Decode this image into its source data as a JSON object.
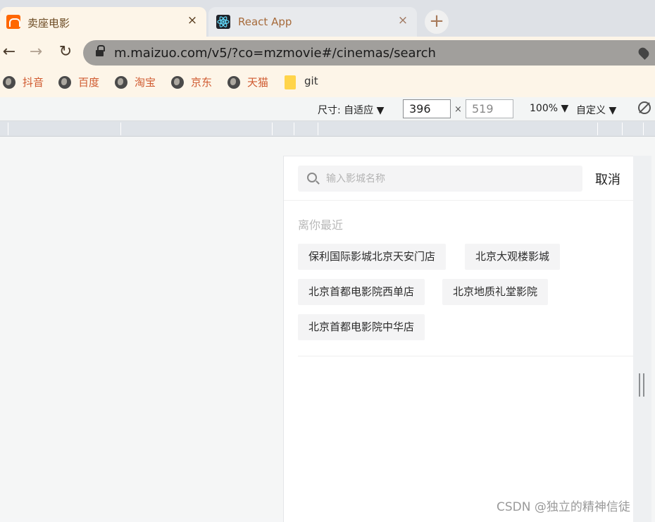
{
  "tabs": [
    {
      "title": "卖座电影",
      "close": "×",
      "active": true,
      "icon": "maizuo-favicon"
    },
    {
      "title": "React App",
      "close": "×",
      "active": false,
      "icon": "react-favicon"
    }
  ],
  "new_tab": "+",
  "nav": {
    "back": "←",
    "forward": "→",
    "reload": "↻"
  },
  "address_bar": {
    "url": "m.maizuo.com/v5/?co=mzmovie#/cinemas/search"
  },
  "bookmarks": [
    {
      "label": "抖音",
      "icon": "globe-icon"
    },
    {
      "label": "百度",
      "icon": "globe-icon"
    },
    {
      "label": "淘宝",
      "icon": "globe-icon"
    },
    {
      "label": "京东",
      "icon": "globe-icon"
    },
    {
      "label": "天猫",
      "icon": "globe-icon"
    },
    {
      "label": "git",
      "icon": "folder-icon"
    }
  ],
  "device_toolbar": {
    "size_label": "尺寸: 自适应 ▼",
    "width": "396",
    "times": "×",
    "height": "519",
    "zoom": "100% ▼",
    "custom": "自定义 ▼"
  },
  "app": {
    "search_placeholder": "输入影城名称",
    "cancel_label": "取消",
    "recent_title": "离你最近",
    "recent_cinemas": [
      "保利国际影城北京天安门店",
      "北京大观楼影城",
      "北京首都电影院西单店",
      "北京地质礼堂影院",
      "北京首都电影院中华店"
    ]
  },
  "watermark": "CSDN @独立的精神信徒",
  "colors": {
    "accent": "#ff6700",
    "tab_active_bg": "#fdf5e8",
    "link_text": "#d05a30"
  }
}
